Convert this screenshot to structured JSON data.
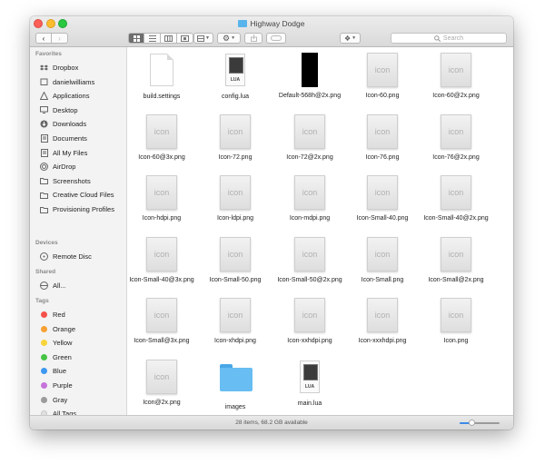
{
  "window": {
    "title": "Highway Dodge"
  },
  "toolbar": {
    "search_placeholder": "Search"
  },
  "sidebar": {
    "favorites_header": "Favorites",
    "favorites": [
      {
        "label": "Dropbox",
        "icon": "dropbox-icon"
      },
      {
        "label": "danielwilliams",
        "icon": "home-icon"
      },
      {
        "label": "Applications",
        "icon": "applications-icon"
      },
      {
        "label": "Desktop",
        "icon": "desktop-icon"
      },
      {
        "label": "Downloads",
        "icon": "downloads-icon"
      },
      {
        "label": "Documents",
        "icon": "documents-icon"
      },
      {
        "label": "All My Files",
        "icon": "all-files-icon"
      },
      {
        "label": "AirDrop",
        "icon": "airdrop-icon"
      },
      {
        "label": "Screenshots",
        "icon": "folder-icon"
      },
      {
        "label": "Creative Cloud Files",
        "icon": "folder-icon"
      },
      {
        "label": "Provisioning Profiles",
        "icon": "folder-icon"
      }
    ],
    "devices_header": "Devices",
    "devices": [
      {
        "label": "Remote Disc",
        "icon": "disc-icon"
      }
    ],
    "shared_header": "Shared",
    "shared": [
      {
        "label": "All...",
        "icon": "network-icon"
      }
    ],
    "tags_header": "Tags",
    "tags": [
      {
        "label": "Red",
        "color": "#f4514a"
      },
      {
        "label": "Orange",
        "color": "#f7a033"
      },
      {
        "label": "Yellow",
        "color": "#f7d43a"
      },
      {
        "label": "Green",
        "color": "#45c443"
      },
      {
        "label": "Blue",
        "color": "#3d98f0"
      },
      {
        "label": "Purple",
        "color": "#c673db"
      },
      {
        "label": "Gray",
        "color": "#9b9b9b"
      },
      {
        "label": "All Tags...",
        "color": "#e0e0e0"
      }
    ]
  },
  "files": [
    {
      "name": "build.settings",
      "kind": "doc"
    },
    {
      "name": "config.lua",
      "kind": "lua"
    },
    {
      "name": "Default-568h@2x.png",
      "kind": "black"
    },
    {
      "name": "Icon-60.png",
      "kind": "icon"
    },
    {
      "name": "Icon-60@2x.png",
      "kind": "icon"
    },
    {
      "name": "Icon-60@3x.png",
      "kind": "icon"
    },
    {
      "name": "Icon-72.png",
      "kind": "icon"
    },
    {
      "name": "Icon-72@2x.png",
      "kind": "icon"
    },
    {
      "name": "Icon-76.png",
      "kind": "icon"
    },
    {
      "name": "Icon-76@2x.png",
      "kind": "icon"
    },
    {
      "name": "Icon-hdpi.png",
      "kind": "icon"
    },
    {
      "name": "Icon-ldpi.png",
      "kind": "icon"
    },
    {
      "name": "Icon-mdpi.png",
      "kind": "icon"
    },
    {
      "name": "Icon-Small-40.png",
      "kind": "icon"
    },
    {
      "name": "Icon-Small-40@2x.png",
      "kind": "icon"
    },
    {
      "name": "Icon-Small-40@3x.png",
      "kind": "icon"
    },
    {
      "name": "Icon-Small-50.png",
      "kind": "icon"
    },
    {
      "name": "Icon-Small-50@2x.png",
      "kind": "icon"
    },
    {
      "name": "Icon-Small.png",
      "kind": "icon"
    },
    {
      "name": "Icon-Small@2x.png",
      "kind": "icon"
    },
    {
      "name": "Icon-Small@3x.png",
      "kind": "icon"
    },
    {
      "name": "Icon-xhdpi.png",
      "kind": "icon"
    },
    {
      "name": "Icon-xxhdpi.png",
      "kind": "icon"
    },
    {
      "name": "Icon-xxxhdpi.png",
      "kind": "icon"
    },
    {
      "name": "Icon.png",
      "kind": "icon"
    },
    {
      "name": "Icon@2x.png",
      "kind": "icon"
    },
    {
      "name": "images",
      "kind": "folder"
    },
    {
      "name": "main.lua",
      "kind": "lua"
    }
  ],
  "thumb": {
    "icon_text": "icon",
    "lua_text": "LUA"
  },
  "status": {
    "text": "28 items, 68.2 GB available",
    "zoom_level": 0.3
  }
}
